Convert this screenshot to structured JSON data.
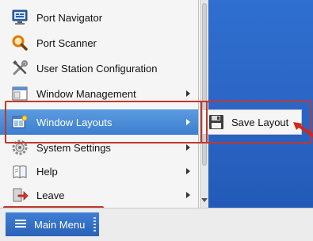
{
  "menu": {
    "items": [
      {
        "label": "Port Navigator",
        "icon": "monitor-icon",
        "has_submenu": false
      },
      {
        "label": "Port Scanner",
        "icon": "magnifier-icon",
        "has_submenu": false
      },
      {
        "label": "User Station Configuration",
        "icon": "tools-icon",
        "has_submenu": false
      },
      {
        "label": "Window Management",
        "icon": "window-icon",
        "has_submenu": true
      },
      {
        "label": "Window Layouts",
        "icon": "layout-icon",
        "has_submenu": true
      },
      {
        "label": "System Settings",
        "icon": "gear-icon",
        "has_submenu": true
      },
      {
        "label": "Help",
        "icon": "book-icon",
        "has_submenu": true
      },
      {
        "label": "Leave",
        "icon": "exit-icon",
        "has_submenu": true
      }
    ]
  },
  "submenu": {
    "item": {
      "label": "Save Layout",
      "icon": "floppy-disk-icon"
    }
  },
  "taskbar": {
    "main_menu_label": "Main Menu",
    "menu_icon": "hamburger-icon"
  },
  "colors": {
    "selection": "#3d7fd0",
    "highlight": "#c0392b",
    "desktop": "#2a63c2",
    "taskbar_button": "#2a62b8"
  }
}
